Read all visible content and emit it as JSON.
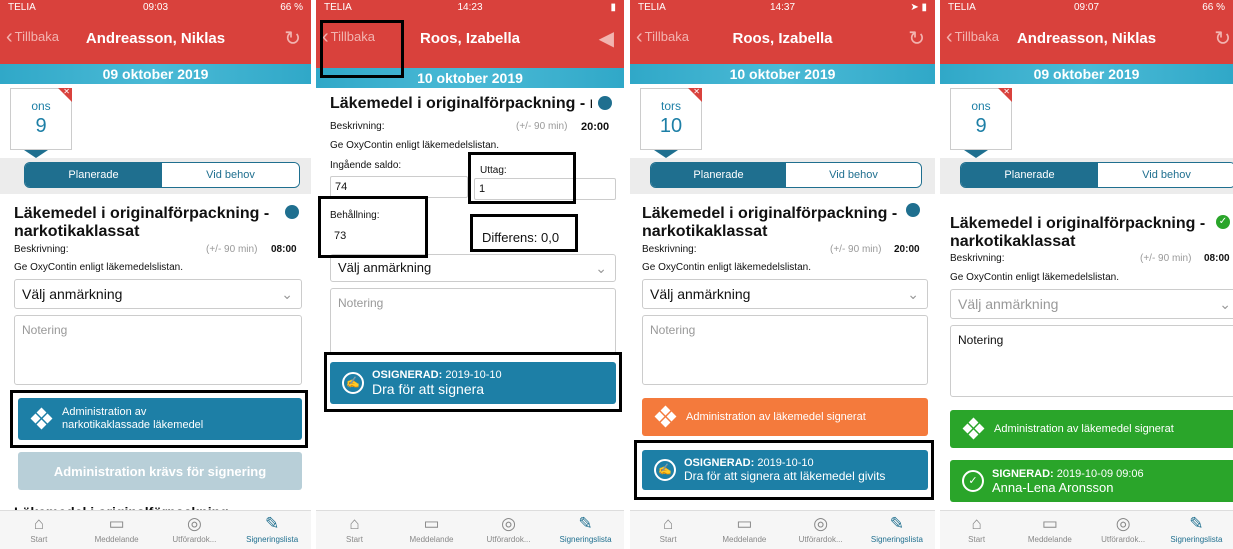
{
  "tabs": {
    "start": "Start",
    "messages": "Meddelande",
    "performed": "Utförardok...",
    "signing": "Signeringslista"
  },
  "icons": {
    "start": "home-icon",
    "messages": "chat-icon",
    "performed": "list-icon",
    "signing": "pencil-icon",
    "refresh": "refresh-icon",
    "clock": "clock-icon",
    "check": "check-icon"
  },
  "colors": {
    "header": "#d9413c",
    "teal": "#1f6f8f",
    "swipe": "#1d7fa6",
    "orange": "#f47a3c",
    "green": "#2aa52a",
    "disabled": "#b8cfd8"
  },
  "common": {
    "back": "Tillbaka",
    "planned": "Planerade",
    "as_needed": "Vid behov",
    "description_label": "Beskrivning:",
    "tolerance": "(+/- 90 min)",
    "instruction": "Ge OxyContin enligt läkemedelslistan.",
    "remark": "Välj anmärkning",
    "note": "Notering",
    "title_full": "Läkemedel i originalförpackning - narkotikaklassat",
    "title_trunc": "Läkemedel i originalförpackning - n:"
  },
  "p1": {
    "carrier": "TELIA",
    "time": "09:03",
    "battery": "66 %",
    "name": "Andreasson, Niklas",
    "date": "09 oktober 2019",
    "weekday": "ons",
    "day": "9",
    "sched_time": "08:00",
    "admin_btn": "Administration av narkotikaklassade läkemedel",
    "required_btn": "Administration krävs för signering",
    "next_item": "Läkemedel i originalförpackning - narkotikaklassat"
  },
  "p2": {
    "carrier": "TELIA",
    "time": "14:23",
    "name": "Roos, Izabella",
    "date": "10 oktober 2019",
    "sched_time": "20:00",
    "in_balance_label": "Ingående saldo:",
    "in_balance": "74",
    "withdrawal_label": "Uttag:",
    "withdrawal": "1",
    "holding_label": "Behållning:",
    "holding": "73",
    "difference": "Differens: 0,0",
    "unsigned": "OSIGNERAD:",
    "unsigned_date": "2019-10-10",
    "swipe": "Dra för att signera"
  },
  "p3": {
    "carrier": "TELIA",
    "time": "14:37",
    "name": "Roos, Izabella",
    "date": "10 oktober 2019",
    "weekday": "tors",
    "day": "10",
    "sched_time": "20:00",
    "signed_btn": "Administration av läkemedel signerat",
    "unsigned": "OSIGNERAD:",
    "unsigned_date": "2019-10-10",
    "swipe": "Dra för att signera att läkemedel givits"
  },
  "p4": {
    "carrier": "TELIA",
    "time": "09:07",
    "battery": "66 %",
    "name": "Andreasson, Niklas",
    "date": "09 oktober 2019",
    "weekday": "ons",
    "day": "9",
    "sched_time": "08:00",
    "note_value": "Notering",
    "signed_btn": "Administration av läkemedel signerat",
    "signed": "SIGNERAD:",
    "signed_date": "2019-10-09 09:06",
    "signer": "Anna-Lena Aronsson"
  }
}
